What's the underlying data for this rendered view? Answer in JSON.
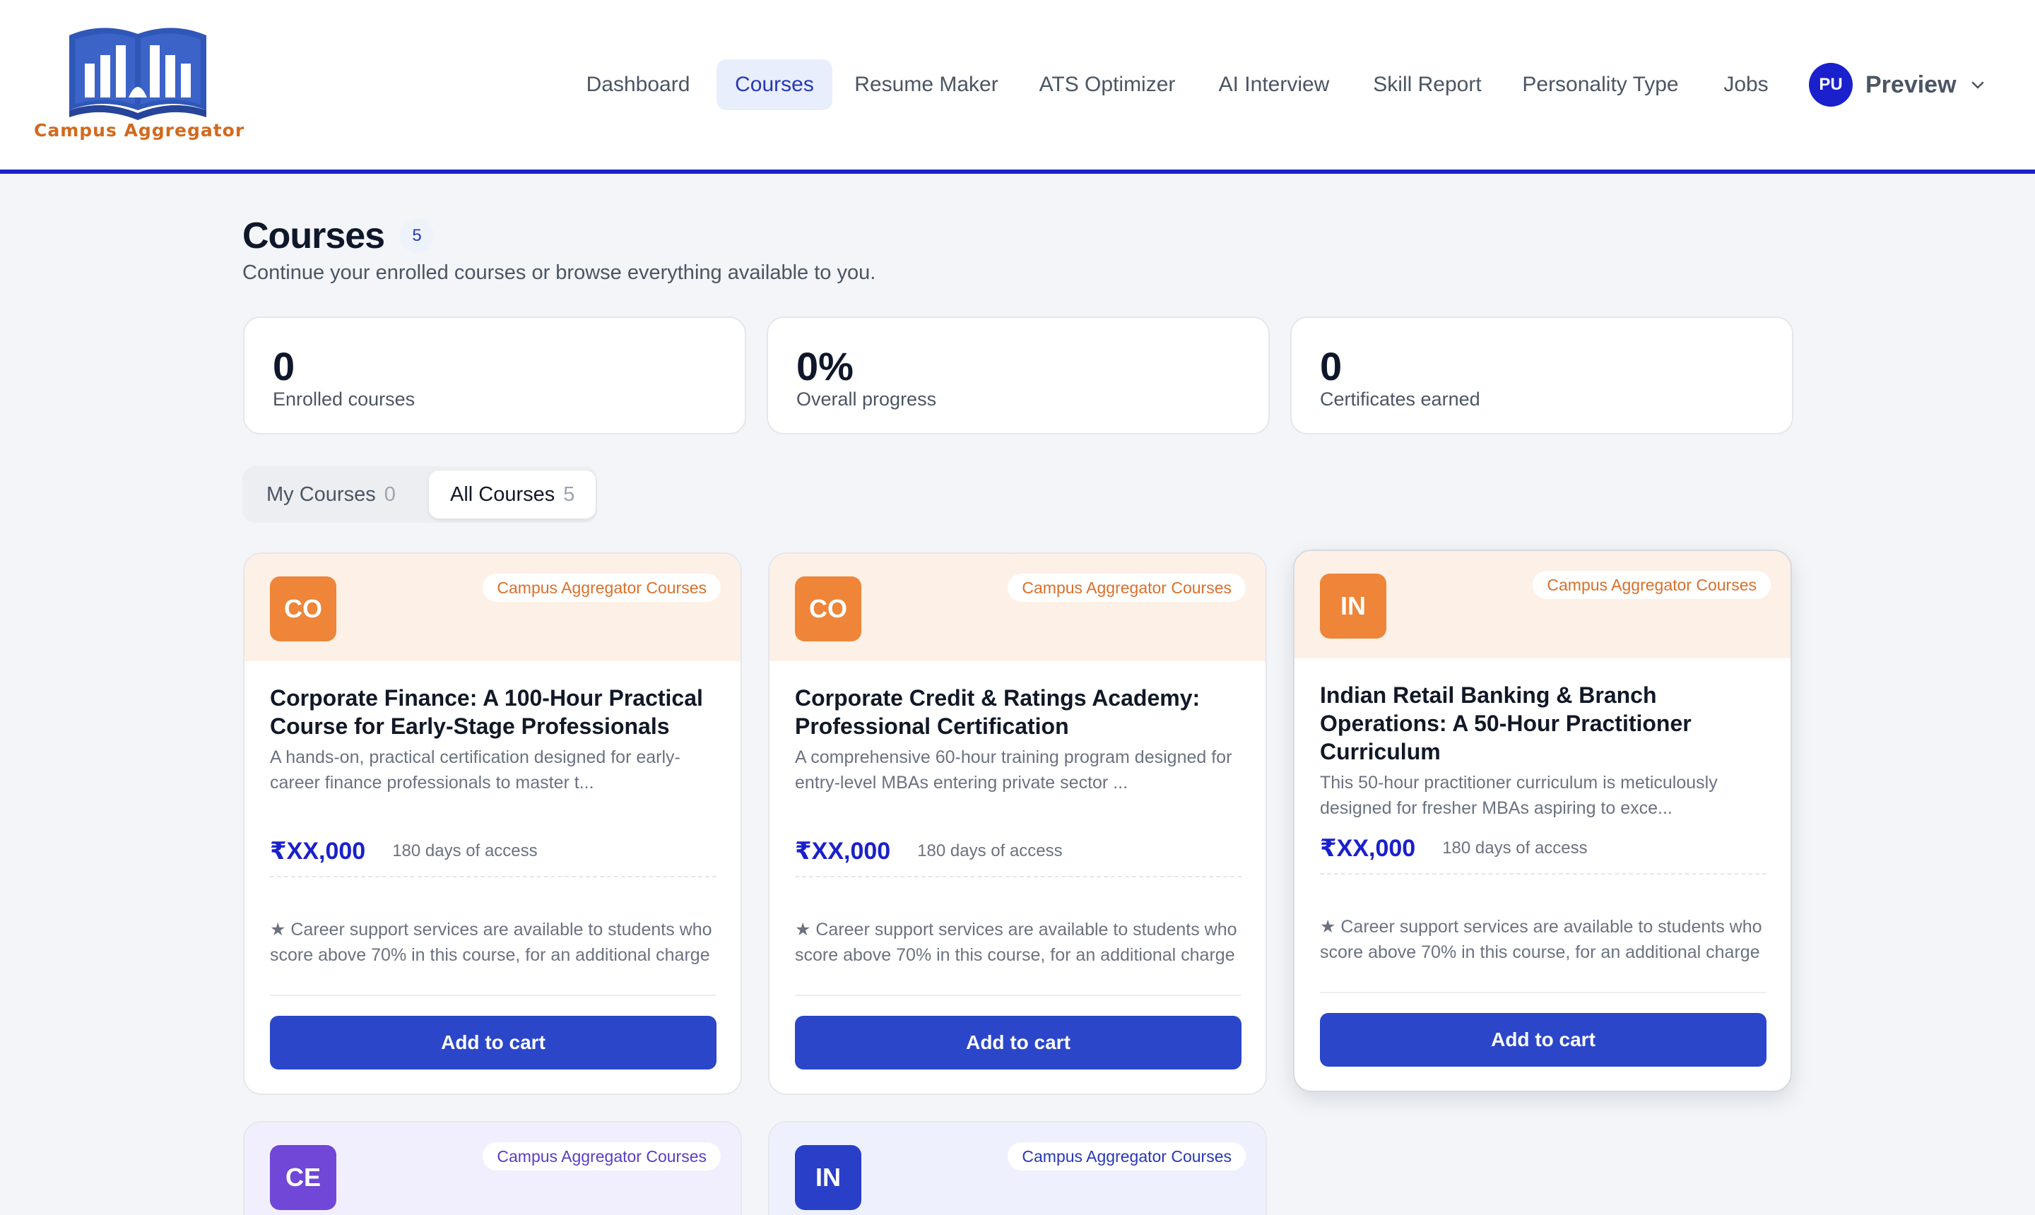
{
  "brand": {
    "name": "Campus Aggregator",
    "color": "#d2691e",
    "book_color": "#2f57b8"
  },
  "nav": {
    "items": [
      {
        "label": "Dashboard",
        "active": false
      },
      {
        "label": "Courses",
        "active": true
      },
      {
        "label": "Resume Maker",
        "active": false
      },
      {
        "label": "ATS Optimizer",
        "active": false
      },
      {
        "label": "AI Interview",
        "active": false
      },
      {
        "label": "Skill Report",
        "active": false
      },
      {
        "label": "Personality Type",
        "active": false
      },
      {
        "label": "Jobs",
        "active": false
      }
    ]
  },
  "user": {
    "initials": "PU",
    "name": "Preview",
    "menu_icon": "chevron-down-icon"
  },
  "page": {
    "title": "Courses",
    "count": "5",
    "subtitle": "Continue your enrolled courses or browse everything available to you."
  },
  "stats": [
    {
      "value": "0",
      "label": "Enrolled courses"
    },
    {
      "value": "0%",
      "label": "Overall progress"
    },
    {
      "value": "0",
      "label": "Certificates earned"
    }
  ],
  "tabs": [
    {
      "label": "My Courses",
      "count": "0",
      "active": false
    },
    {
      "label": "All Courses",
      "count": "5",
      "active": true
    }
  ],
  "courses": [
    {
      "initials": "CO",
      "provider": "Campus Aggregator Courses",
      "title": "Corporate Finance: A 100-Hour Practical Course for Early-Stage Professionals",
      "description": "A hands-on, practical certification designed for early-career finance professionals to master t...",
      "price": "₹XX,000",
      "access": "180 days of access",
      "support": "★ Career support services are available to students who score above 70% in this course, for an additional charge",
      "button": "Add to cart",
      "theme": "orange"
    },
    {
      "initials": "CO",
      "provider": "Campus Aggregator Courses",
      "title": "Corporate Credit & Ratings Academy: Professional Certification",
      "description": "A comprehensive 60-hour training program designed for entry-level MBAs entering private sector ...",
      "price": "₹XX,000",
      "access": "180 days of access",
      "support": "★ Career support services are available to students who score above 70% in this course, for an additional charge",
      "button": "Add to cart",
      "theme": "orange"
    },
    {
      "initials": "IN",
      "provider": "Campus Aggregator Courses",
      "title": "Indian Retail Banking & Branch Operations: A 50-Hour Practitioner Curriculum",
      "description": "This 50-hour practitioner curriculum is meticulously designed for fresher MBAs aspiring to exce...",
      "price": "₹XX,000",
      "access": "180 days of access",
      "support": "★ Career support services are available to students who score above 70% in this course, for an additional charge",
      "button": "Add to cart",
      "theme": "orange"
    },
    {
      "initials": "CE",
      "provider": "Campus Aggregator Courses",
      "theme": "purple"
    },
    {
      "initials": "IN",
      "provider": "Campus Aggregator Courses",
      "theme": "blue"
    }
  ],
  "colors": {
    "accent": "#1a20cc",
    "button": "#2b46c9",
    "page_bg": "#f3f5f8"
  }
}
